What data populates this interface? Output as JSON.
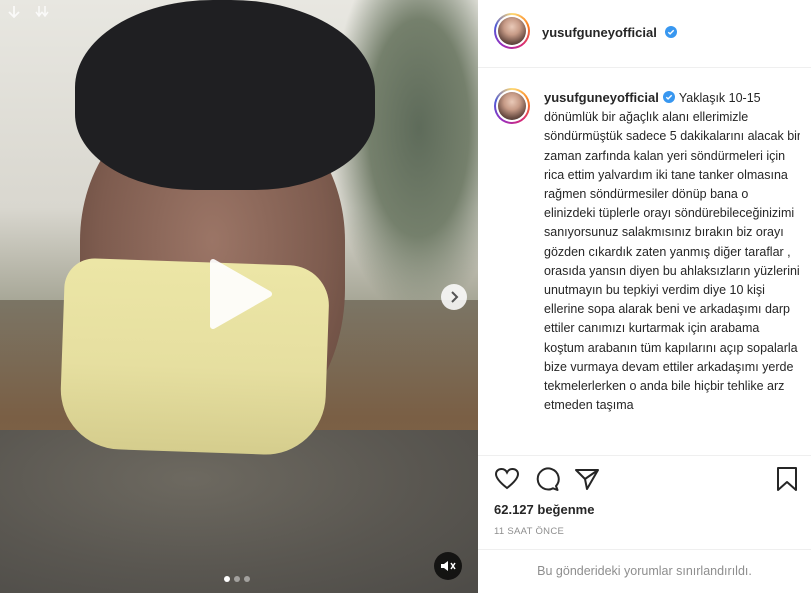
{
  "profile": {
    "username": "yusufguneyofficial",
    "verified": true
  },
  "post": {
    "caption": "Yaklaşık 10-15 dönümlük bir ağaçlık alanı ellerimizle söndürmüştük sadece 5 dakikalarını alacak bir zaman zarfında kalan yeri söndürmeleri için rica ettim yalvardım iki tane tanker olmasına rağmen söndürmesiler dönüp bana o elinizdeki tüplerle orayı söndürebileceğinizimi sanıyorsunuz salakmısınız bırakın biz orayı gözden cıkardık zaten yanmış diğer taraflar , orasıda yansın diyen bu ahlaksızların yüzlerini unutmayın bu tepkiyi verdim diye 10 kişi ellerine sopa alarak beni ve arkadaşımı darp ettiler canımızı kurtarmak için arabama koştum arabanın tüm kapılarını açıp sopalarla bize vurmaya devam ettiler arkadaşımı yerde tekmelerlerken o anda bile hiçbir tehlike arz etmeden taşıma",
    "likes_count": "62.127",
    "likes_label": "beğenme",
    "timestamp": "11 SAAT ÖNCE",
    "comments_disabled": "Bu gönderideki yorumlar sınırlandırıldı."
  },
  "media": {
    "carousel_count": 3,
    "carousel_active_index": 0,
    "type": "video",
    "muted": true
  },
  "icons": {
    "play": "play-icon",
    "next": "chevron-right-icon",
    "mute": "speaker-muted-icon",
    "like": "heart-icon",
    "comment": "comment-icon",
    "share": "paper-plane-icon",
    "save": "bookmark-icon",
    "verified": "verified-badge-icon"
  },
  "colors": {
    "verified": "#3897f0",
    "text": "#262626",
    "muted_text": "#8e8e8e"
  }
}
